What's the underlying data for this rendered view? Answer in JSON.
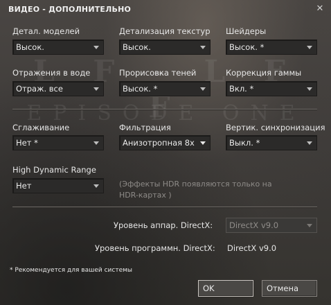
{
  "window": {
    "title": "ВИДЕО - ДОПОЛНИТЕЛЬНО"
  },
  "background": {
    "logo_line1": "L F - L F F",
    "logo_line2": "EPISODE ONE"
  },
  "settings": {
    "model_detail": {
      "label": "Детал. моделей",
      "value": "Высок."
    },
    "texture_detail": {
      "label": "Детализация текстур",
      "value": "Высок."
    },
    "shaders": {
      "label": "Шейдеры",
      "value": "Высок. *"
    },
    "water_reflections": {
      "label": "Отражения в воде",
      "value": "Отраж. все"
    },
    "shadow_detail": {
      "label": "Прорисовка теней",
      "value": "Высок. *"
    },
    "gamma": {
      "label": "Коррекция гаммы",
      "value": "Вкл. *"
    },
    "antialiasing": {
      "label": "Сглаживание",
      "value": "Нет *"
    },
    "filtering": {
      "label": "Фильтрация",
      "value": "Анизотропная 8x"
    },
    "vsync": {
      "label": "Вертик. синхронизация",
      "value": "Выкл. *"
    },
    "hdr": {
      "label": "High Dynamic Range",
      "value": "Нет"
    }
  },
  "hdr_note": {
    "line1": "(Эффекты HDR появляются только на",
    "line2": "HDR-картах )"
  },
  "directx": {
    "hardware_label": "Уровень аппар. DirectX:",
    "hardware_value": "DirectX v9.0",
    "software_label": "Уровень программн. DirectX:",
    "software_value": "DirectX v9.0"
  },
  "footnote": "* Рекомендуется для вашей системы",
  "buttons": {
    "ok": "OK",
    "cancel": "Отмена"
  }
}
